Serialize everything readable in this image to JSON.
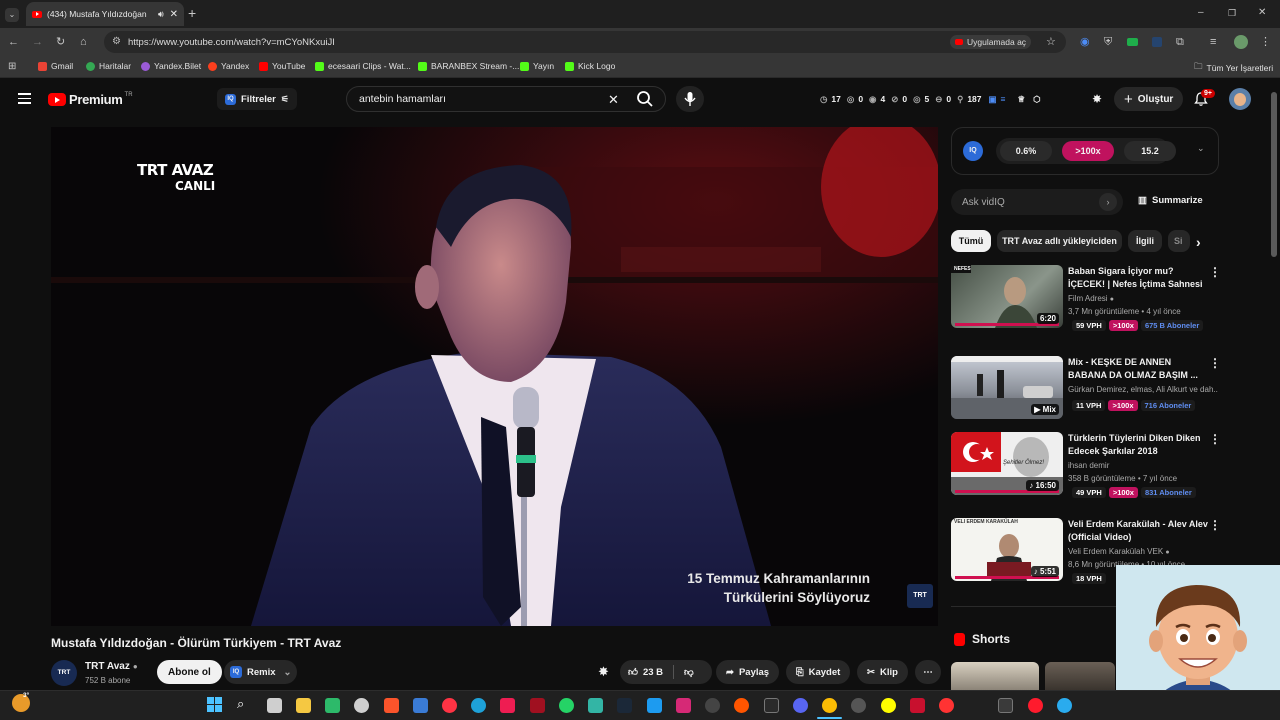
{
  "browser": {
    "tab_title": "(434) Mustafa Yıldızdoğan",
    "url": "https://www.youtube.com/watch?v=mCYoNKxuiJI",
    "open_in_app": "Uygulamada aç",
    "bookmarks": [
      "Gmail",
      "Haritalar",
      "Yandex.Bilet",
      "Yandex",
      "YouTube",
      "ecesaari Clips - Wat...",
      "BARANBEX Stream -...",
      "Yayın",
      "Kick Logo"
    ],
    "all_bookmarks": "Tüm Yer İşaretleri"
  },
  "youtube": {
    "logo": "Premium",
    "logo_region": "TR",
    "filters": "Filtreler",
    "search_value": "antebin hamamları",
    "stats": [
      "17",
      "0",
      "4",
      "0",
      "5",
      "0",
      "187"
    ],
    "create": "Oluştur",
    "notif_badge": "9+"
  },
  "video": {
    "channel_watermark_top": "TRT AVAZ",
    "channel_watermark_bottom": "CANLI",
    "subtitle_line1": "15 Temmuz Kahramanlarının",
    "subtitle_line2": "Türkülerini Söylüyoruz",
    "corner_logo": "TRT",
    "title": "Mustafa Yıldızdoğan - Ölürüm Türkiyem - TRT Avaz",
    "channel": "TRT Avaz",
    "subscribers": "752 B abone",
    "subscribe": "Abone ol",
    "remix": "Remix",
    "likes": "23 B",
    "share": "Paylaş",
    "save": "Kaydet",
    "clip": "Klip"
  },
  "vidiq": {
    "stat1": "0.6%",
    "stat2": ">100x",
    "stat3": "15.2",
    "ask_placeholder": "Ask vidIQ",
    "summarize": "Summarize"
  },
  "chips": [
    "Tümü",
    "TRT Avaz adlı yükleyiciden",
    "İlgili",
    "Si"
  ],
  "related": [
    {
      "title": "Baban Sigara İçiyor mu? İÇECEK! | Nefes İçtima Sahnesi",
      "channel": "Film Adresi",
      "meta": "3,7 Mn görüntüleme • 4 yıl önce",
      "duration": "6:20",
      "vph": "59 VPH",
      "mult": ">100x",
      "subs": "675 B Aboneler",
      "thumb_label": "NEFES"
    },
    {
      "title": "Mix - KEŞKE DE ANNEN BABANA DA OLMAZ BAŞIM ...",
      "channel": "Gürkan Demirez, elmas, Ali Alkurt ve dah...",
      "meta": "",
      "duration": "Mix",
      "vph": "11 VPH",
      "mult": ">100x",
      "subs": "716 Aboneler",
      "thumb_label": ""
    },
    {
      "title": "Türklerin Tüylerini Diken Diken Edecek Şarkılar 2018",
      "channel": "ihsan demir",
      "meta": "358 B görüntüleme • 7 yıl önce",
      "duration": "16:50",
      "vph": "49 VPH",
      "mult": ">100x",
      "subs": "831 Aboneler",
      "thumb_label": "Şehitler Ölmez!"
    },
    {
      "title": "Veli Erdem Karakülah - Alev Alev (Official Video)",
      "channel": "Veli Erdem Karakülah VEK",
      "meta": "8,6 Mn görüntüleme • 10 yıl önce",
      "duration": "5:51",
      "vph": "18 VPH",
      "mult": "",
      "subs": "",
      "thumb_label": "VELI ERDEM KARAKÜLAH"
    }
  ],
  "shorts": "Shorts",
  "taskbar": {
    "weather_badge": "3°"
  }
}
